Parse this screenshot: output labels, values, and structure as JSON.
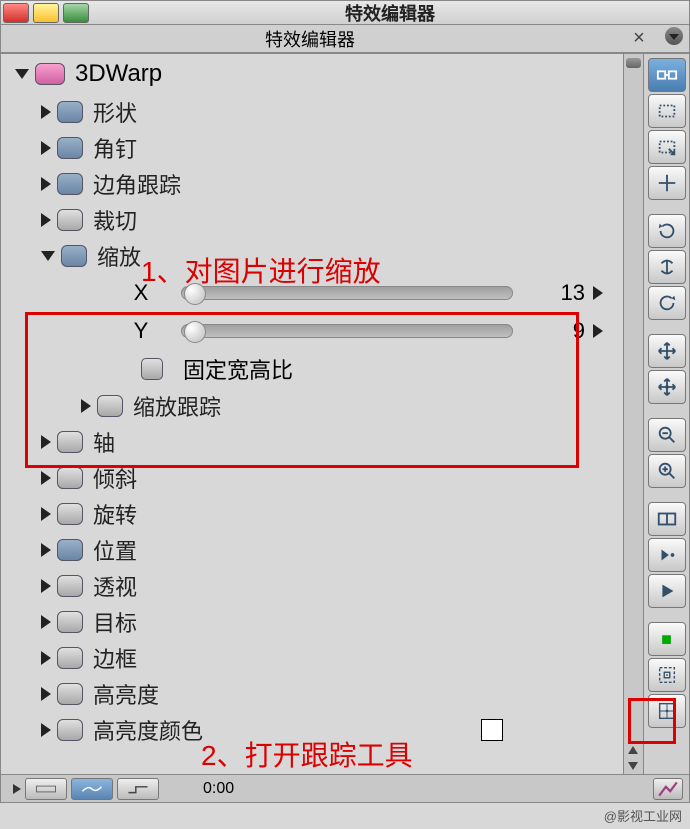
{
  "window": {
    "title": "特效编辑器"
  },
  "tab": {
    "label": "特效编辑器"
  },
  "tree": {
    "root": "3DWarp",
    "items": [
      {
        "label": "形状"
      },
      {
        "label": "角钉"
      },
      {
        "label": "边角跟踪"
      },
      {
        "label": "裁切"
      },
      {
        "label": "缩放"
      },
      {
        "label": "缩放跟踪"
      },
      {
        "label": "轴"
      },
      {
        "label": "倾斜"
      },
      {
        "label": "旋转"
      },
      {
        "label": "位置"
      },
      {
        "label": "透视"
      },
      {
        "label": "目标"
      },
      {
        "label": "边框"
      },
      {
        "label": "高亮度"
      },
      {
        "label": "高亮度颜色"
      }
    ]
  },
  "scale": {
    "x_label": "X",
    "y_label": "Y",
    "x_value": "13",
    "y_value": "9",
    "lock_label": "固定宽高比"
  },
  "annotations": {
    "a1": "1、对图片进行缩放",
    "a2": "2、打开跟踪工具"
  },
  "bottom": {
    "time": "0:00"
  },
  "watermark": "@影视工业网"
}
